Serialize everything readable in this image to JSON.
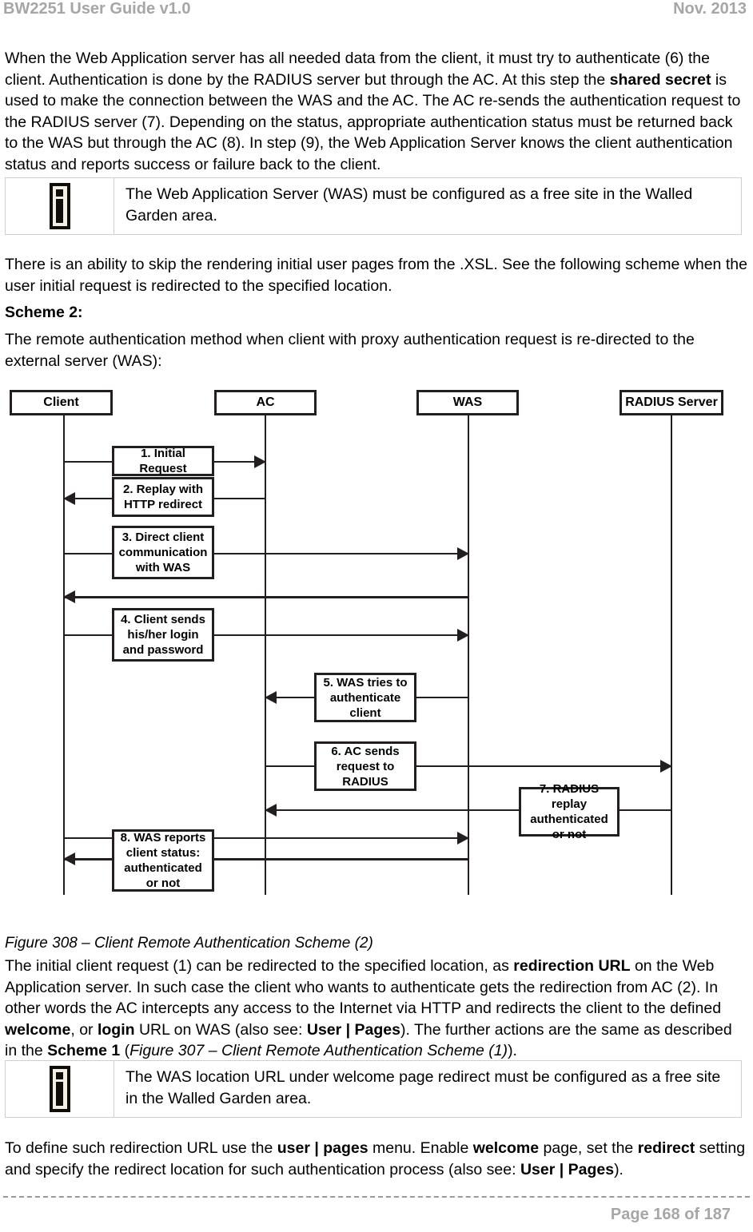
{
  "header": {
    "doc_title": "BW2251 User Guide v1.0",
    "date": "Nov.  2013"
  },
  "footer": {
    "page_label": "Page 168 of 187"
  },
  "body": {
    "para1_a": "When the Web Application server has all needed data from the client, it must try to authenticate (6) the client. Authentication is done by the RADIUS server but through the AC. At this step the ",
    "para1_bold1": "shared secret",
    "para1_b": " is used to make the connection between the WAS and the AC. The AC re-sends the authentication request to the RADIUS server (7). Depending on the status, appropriate authentication status must be returned back to the WAS but through the AC (8).  In step (9), the Web Application Server knows the client authentication status and reports success or failure back to the client.",
    "note1_text": "The Web Application Server (WAS) must be configured as a free site in the Walled Garden area.",
    "para2": "There is an ability to skip the rendering initial user pages from the .XSL. See the following scheme when the user initial request is redirected to the specified location.",
    "heading_scheme2": "Scheme 2:",
    "para3": "The remote authentication method when client with proxy authentication request is re-directed to the external server (WAS):",
    "caption": "Figure 308  – Client Remote Authentication Scheme (2)",
    "para4_a": "The initial client request (1) can be redirected to the specified location, as ",
    "para4_bold1": "redirection URL",
    "para4_b": " on the Web Application server. In such case the client who wants to authenticate gets the redirection from AC (2). In other words the AC intercepts any access to the Internet via HTTP and redirects the client to the defined ",
    "para4_bold2": "welcome",
    "para4_c": ", or ",
    "para4_bold3": "login",
    "para4_d": " URL on WAS (also see: ",
    "para4_bold4": "User | Pages",
    "para4_e": "). The further actions are the same as described in the ",
    "para4_bold5": "Scheme 1",
    "para4_f": " (",
    "para4_italic1": "Figure 307  – Client Remote Authentication Scheme (1)",
    "para4_g": ").",
    "note2_text": "The WAS location URL under welcome page redirect must be configured as a free site in the Walled Garden area.",
    "para5_a": "To define such redirection URL use the ",
    "para5_bold1": "user | pages",
    "para5_b": " menu. Enable ",
    "para5_bold2": "welcome",
    "para5_c": " page, set the ",
    "para5_bold3": "redirect",
    "para5_d": " setting and specify the redirect location for such authentication process (also see: ",
    "para5_bold4": "User | Pages",
    "para5_e": ")."
  },
  "note_icon": {
    "name": "info-icon",
    "glyph": "i"
  },
  "diagram": {
    "title": "Client Remote Authentication Scheme (2)",
    "lifelines": [
      {
        "id": "client",
        "label": "Client"
      },
      {
        "id": "ac",
        "label": "AC"
      },
      {
        "id": "was",
        "label": "WAS"
      },
      {
        "id": "radius",
        "label": "RADIUS Server"
      }
    ],
    "messages": [
      {
        "num": "1",
        "label": "1. Initial Request",
        "from": "client",
        "to": "ac",
        "direction": "right"
      },
      {
        "num": "2",
        "label": "2. Replay with HTTP redirect",
        "from": "ac",
        "to": "client",
        "direction": "left"
      },
      {
        "num": "3",
        "label": "3. Direct client communication with WAS",
        "from": "client",
        "to": "was",
        "direction": "right"
      },
      {
        "num": "",
        "label": "",
        "from": "was",
        "to": "client",
        "direction": "left"
      },
      {
        "num": "4",
        "label": "4. Client sends his/her login and password",
        "from": "client",
        "to": "was",
        "direction": "right"
      },
      {
        "num": "5",
        "label": "5. WAS tries to authenticate client",
        "from": "was",
        "to": "ac",
        "direction": "left"
      },
      {
        "num": "6",
        "label": "6. AC sends request to RADIUS",
        "from": "ac",
        "to": "radius",
        "direction": "right"
      },
      {
        "num": "7",
        "label": "7. RADIUS replay authenticated or not",
        "from": "radius",
        "to": "ac",
        "direction": "left"
      },
      {
        "num": "",
        "label": "",
        "from": "ac",
        "to": "was",
        "direction": "right"
      },
      {
        "num": "8",
        "label": "8. WAS reports client status: authenticated or not",
        "from": "was",
        "to": "client",
        "direction": "left"
      }
    ]
  }
}
